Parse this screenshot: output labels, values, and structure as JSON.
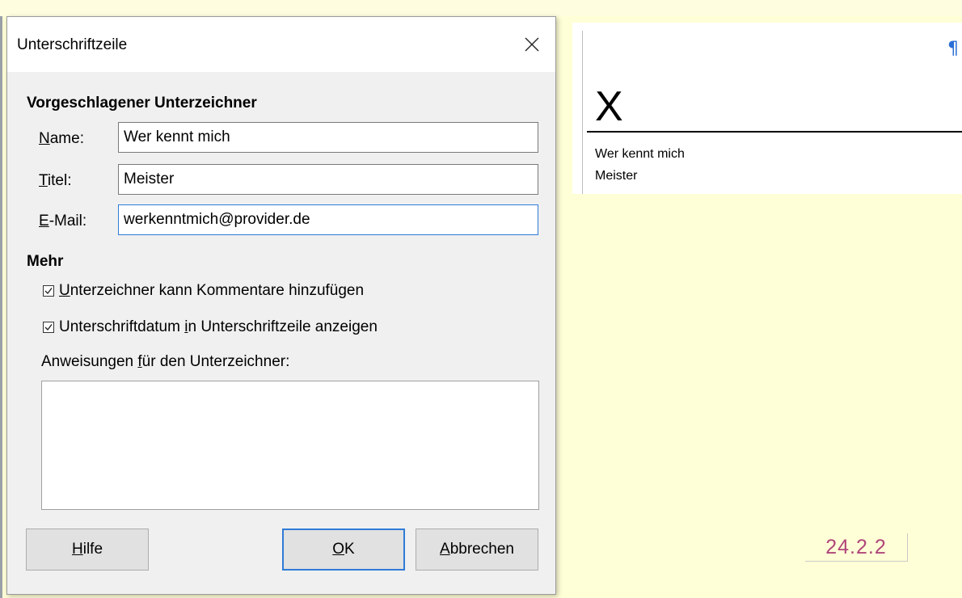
{
  "dialog": {
    "title": "Unterschriftzeile",
    "close_icon": "close-icon",
    "signer_heading": "Vorgeschlagener Unterzeichner",
    "name_label_u": "N",
    "name_label_rest": "ame:",
    "name_value": "Wer kennt mich",
    "title_label_u": "T",
    "title_label_rest": "itel:",
    "title_value": "Meister",
    "email_label_u": "E",
    "email_label_rest": "-Mail:",
    "email_value": "werkenntmich@provider.de",
    "more_heading": "Mehr",
    "allow_comments_u": "U",
    "allow_comments_rest": "nterzeichner kann Kommentare hinzufügen",
    "allow_comments_checked": true,
    "show_date_pre": "Unterschriftdatum ",
    "show_date_u": "i",
    "show_date_rest": "n Unterschriftzeile anzeigen",
    "show_date_checked": true,
    "instructions_pre": "Anweisungen ",
    "instructions_u": "f",
    "instructions_rest": "ür den Unterzeichner:",
    "instructions_value": "",
    "help_u": "H",
    "help_rest": "ilfe",
    "ok_u": "O",
    "ok_rest": "K",
    "cancel_u": "A",
    "cancel_rest": "bbrechen"
  },
  "document": {
    "pilcrow": "¶",
    "signature_mark": "X",
    "signer_name": "Wer kennt mich",
    "signer_title": "Meister"
  },
  "version_badge": "24.2.2",
  "colors": {
    "page_background": "#ffffd7",
    "focus_accent": "#2f7bd6",
    "version_text": "#b0457a",
    "pilcrow": "#2a6fd6"
  }
}
